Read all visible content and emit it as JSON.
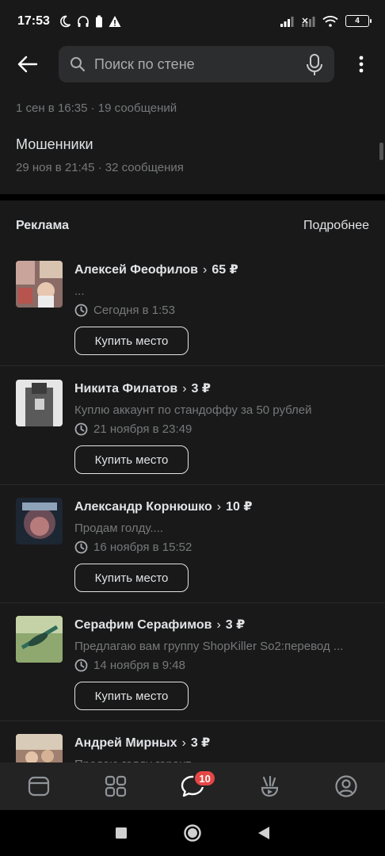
{
  "status_bar": {
    "time": "17:53",
    "battery": "4"
  },
  "search": {
    "placeholder": "Поиск по стене"
  },
  "topics": [
    {
      "title": "",
      "meta": "1 сен в 16:35 · 19 сообщений"
    },
    {
      "title": "Мошенники",
      "meta": "29 ноя в 21:45 · 32 сообщения"
    }
  ],
  "ads": {
    "title": "Реклама",
    "more_label": "Подробнее",
    "items": [
      {
        "name": "Алексей Феофилов",
        "price": "65 ₽",
        "text": "...",
        "time": "Сегодня в 1:53",
        "button": "Купить место"
      },
      {
        "name": "Никита Филатов",
        "price": "3 ₽",
        "text": "Куплю аккаунт по стандоффу за 50 рублей",
        "time": "21 ноября в 23:49",
        "button": "Купить место"
      },
      {
        "name": "Александр Корнюшко",
        "price": "10 ₽",
        "text": "Продам голду....",
        "time": "16 ноября в 15:52",
        "button": "Купить место"
      },
      {
        "name": "Серафим Серафимов",
        "price": "3 ₽",
        "text": "Предлагаю вам группу ShopKiller So2:перевод ...",
        "time": "14 ноября в 9:48",
        "button": "Купить место"
      },
      {
        "name": "Андрей Мирных",
        "price": "3 ₽",
        "text": "Продаю голду гарант",
        "time": "",
        "button": ""
      }
    ]
  },
  "tabs": {
    "messages_badge": "10"
  },
  "colors": {
    "background": "#191919",
    "accent_badge": "#e64646",
    "secondary_text": "#76787a"
  }
}
